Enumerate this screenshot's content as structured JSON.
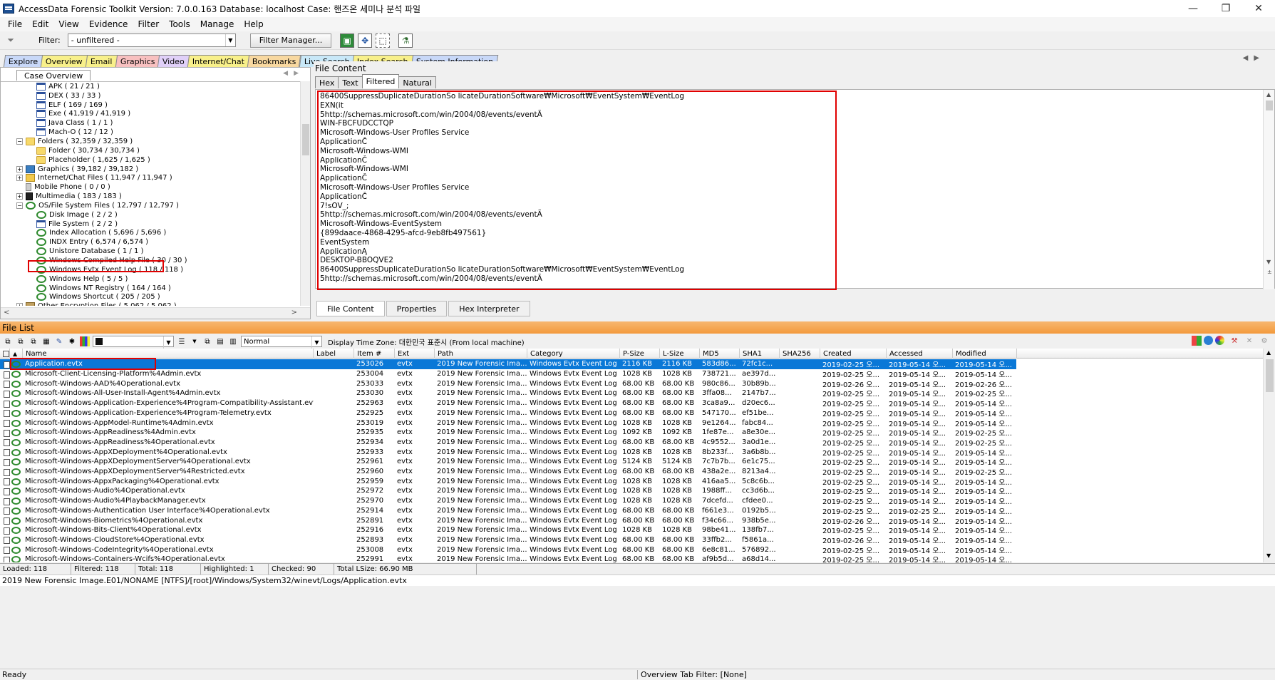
{
  "window": {
    "title": "AccessData Forensic Toolkit Version: 7.0.0.163 Database: localhost Case: 핸즈온 세미나 분석 파일",
    "minimize": "—",
    "maximize": "❐",
    "close": "✕"
  },
  "menu": [
    "File",
    "Edit",
    "View",
    "Evidence",
    "Filter",
    "Tools",
    "Manage",
    "Help"
  ],
  "toolbar": {
    "filter_label": "Filter:",
    "filter_value": "- unfiltered -",
    "filter_manager": "Filter Manager..."
  },
  "main_tabs": [
    {
      "label": "Explore",
      "color": "#c8d8f8"
    },
    {
      "label": "Overview",
      "color": "#f8f08a"
    },
    {
      "label": "Email",
      "color": "#f8f08a"
    },
    {
      "label": "Graphics",
      "color": "#f8c0c0"
    },
    {
      "label": "Video",
      "color": "#e0d0f8"
    },
    {
      "label": "Internet/Chat",
      "color": "#f8f08a"
    },
    {
      "label": "Bookmarks",
      "color": "#f8d8a0"
    },
    {
      "label": "Live Search",
      "color": "#c8e8f8"
    },
    {
      "label": "Index Search",
      "color": "#f8f08a"
    },
    {
      "label": "System Information",
      "color": "#c8d8f8"
    }
  ],
  "tree": {
    "tab": "Case Overview",
    "rows": [
      {
        "label": "APK ( 21 / 21 )",
        "indent": 2,
        "icon": "doc"
      },
      {
        "label": "DEX ( 33 / 33 )",
        "indent": 2,
        "icon": "doc"
      },
      {
        "label": "ELF ( 169 / 169 )",
        "indent": 2,
        "icon": "doc"
      },
      {
        "label": "Exe ( 41,919 / 41,919 )",
        "indent": 2,
        "icon": "doc"
      },
      {
        "label": "Java Class ( 1 / 1 )",
        "indent": 2,
        "icon": "doc"
      },
      {
        "label": "Mach-O ( 12 / 12 )",
        "indent": 2,
        "icon": "doc"
      },
      {
        "label": "Folders ( 32,359 / 32,359 )",
        "indent": 1,
        "icon": "folder",
        "exp": "−"
      },
      {
        "label": "Folder ( 30,734 / 30,734 )",
        "indent": 2,
        "icon": "folder"
      },
      {
        "label": "Placeholder ( 1,625 / 1,625 )",
        "indent": 2,
        "icon": "folder"
      },
      {
        "label": "Graphics ( 39,182 / 39,182 )",
        "indent": 1,
        "icon": "gfx",
        "exp": "+"
      },
      {
        "label": "Internet/Chat Files ( 11,947 / 11,947 )",
        "indent": 1,
        "icon": "chat",
        "exp": "+"
      },
      {
        "label": "Mobile Phone ( 0 / 0 )",
        "indent": 1,
        "icon": "mobile"
      },
      {
        "label": "Multimedia ( 183 / 183 )",
        "indent": 1,
        "icon": "media",
        "exp": "+"
      },
      {
        "label": "OS/File System Files ( 12,797 / 12,797 )",
        "indent": 1,
        "icon": "evt",
        "exp": "−"
      },
      {
        "label": "Disk Image ( 2 / 2 )",
        "indent": 2,
        "icon": "evt"
      },
      {
        "label": "File System ( 2 / 2 )",
        "indent": 2,
        "icon": "doc"
      },
      {
        "label": "Index Allocation ( 5,696 / 5,696 )",
        "indent": 2,
        "icon": "evt"
      },
      {
        "label": "INDX Entry ( 6,574 / 6,574 )",
        "indent": 2,
        "icon": "evt"
      },
      {
        "label": "Unistore Database ( 1 / 1 )",
        "indent": 2,
        "icon": "evt"
      },
      {
        "label": "Windows Compiled Help File ( 30 / 30 )",
        "indent": 2,
        "icon": "evt"
      },
      {
        "label": "Windows Evtx Event Log ( 118 / 118 )",
        "indent": 2,
        "icon": "evt"
      },
      {
        "label": "Windows Help ( 5 / 5 )",
        "indent": 2,
        "icon": "evt"
      },
      {
        "label": "Windows NT Registry ( 164 / 164 )",
        "indent": 2,
        "icon": "evt"
      },
      {
        "label": "Windows Shortcut ( 205 / 205 )",
        "indent": 2,
        "icon": "evt"
      },
      {
        "label": "Other Encryption Files ( 5,062 / 5,062 )",
        "indent": 1,
        "icon": "key",
        "exp": "+"
      }
    ]
  },
  "file_content": {
    "title": "File Content",
    "tabs": [
      "Hex",
      "Text",
      "Filtered",
      "Natural"
    ],
    "active_tab": "Filtered",
    "lines": [
      "86400SuppressDuplicateDurationSo licateDurationSoftware₩Microsoft₩EventSystem₩EventLog",
      "EXN(it",
      "5http://schemas.microsoft.com/win/2004/08/events/eventÃ",
      "WIN-FBCFUDCCTQP",
      "Microsoft-Windows-User Profiles Service",
      "ApplicationČ",
      "Microsoft-Windows-WMI",
      "ApplicationČ",
      "Microsoft-Windows-WMI",
      "ApplicationČ",
      "Microsoft-Windows-User Profiles Service",
      "ApplicationČ",
      "7!sOV_;",
      "5http://schemas.microsoft.com/win/2004/08/events/eventÃ",
      "Microsoft-Windows-EventSystem",
      "{899daace-4868-4295-afcd-9eb8fb497561}",
      "EventSystem",
      "ApplicationĄ",
      "DESKTOP-BBOQVE2",
      "86400SuppressDuplicateDurationSo licateDurationSoftware₩Microsoft₩EventSystem₩EventLog",
      "5http://schemas.microsoft.com/win/2004/08/events/eventÃ"
    ],
    "bottom_tabs": [
      "File Content",
      "Properties",
      "Hex Interpreter"
    ]
  },
  "file_list": {
    "title": "File List",
    "view_mode": "Normal",
    "timezone": "Display Time Zone: 대한민국 표준시  (From local machine)",
    "columns": [
      "Name",
      "Label",
      "Item #",
      "Ext",
      "Path",
      "Category",
      "P-Size",
      "L-Size",
      "MD5",
      "SHA1",
      "SHA256",
      "Created",
      "Accessed",
      "Modified"
    ],
    "rows": [
      {
        "name": "Application.evtx",
        "item": "253026",
        "ext": "evtx",
        "path": "2019 New Forensic Ima...",
        "cat": "Windows Evtx Event Log",
        "ps": "2116 KB",
        "ls": "2116 KB",
        "md5": "583d86...",
        "sha1": "72fc1c...",
        "created": "2019-02-25 오...",
        "accessed": "2019-05-14 오...",
        "modified": "2019-05-14 오..."
      },
      {
        "name": "Microsoft-Client-Licensing-Platform%4Admin.evtx",
        "item": "253004",
        "ext": "evtx",
        "path": "2019 New Forensic Ima...",
        "cat": "Windows Evtx Event Log",
        "ps": "1028 KB",
        "ls": "1028 KB",
        "md5": "738721...",
        "sha1": "ae397d...",
        "created": "2019-02-25 오...",
        "accessed": "2019-05-14 오...",
        "modified": "2019-05-14 오..."
      },
      {
        "name": "Microsoft-Windows-AAD%4Operational.evtx",
        "item": "253033",
        "ext": "evtx",
        "path": "2019 New Forensic Ima...",
        "cat": "Windows Evtx Event Log",
        "ps": "68.00 KB",
        "ls": "68.00 KB",
        "md5": "980c86...",
        "sha1": "30b89b...",
        "created": "2019-02-26 오...",
        "accessed": "2019-05-14 오...",
        "modified": "2019-02-26 오..."
      },
      {
        "name": "Microsoft-Windows-All-User-Install-Agent%4Admin.evtx",
        "item": "253030",
        "ext": "evtx",
        "path": "2019 New Forensic Ima...",
        "cat": "Windows Evtx Event Log",
        "ps": "68.00 KB",
        "ls": "68.00 KB",
        "md5": "3ffa08...",
        "sha1": "2147b7...",
        "created": "2019-02-25 오...",
        "accessed": "2019-05-14 오...",
        "modified": "2019-02-25 오..."
      },
      {
        "name": "Microsoft-Windows-Application-Experience%4Program-Compatibility-Assistant.evtx",
        "item": "252963",
        "ext": "evtx",
        "path": "2019 New Forensic Ima...",
        "cat": "Windows Evtx Event Log",
        "ps": "68.00 KB",
        "ls": "68.00 KB",
        "md5": "3ca8a9...",
        "sha1": "d20ec6...",
        "created": "2019-02-25 오...",
        "accessed": "2019-05-14 오...",
        "modified": "2019-05-14 오..."
      },
      {
        "name": "Microsoft-Windows-Application-Experience%4Program-Telemetry.evtx",
        "item": "252925",
        "ext": "evtx",
        "path": "2019 New Forensic Ima...",
        "cat": "Windows Evtx Event Log",
        "ps": "68.00 KB",
        "ls": "68.00 KB",
        "md5": "547170...",
        "sha1": "ef51be...",
        "created": "2019-02-25 오...",
        "accessed": "2019-05-14 오...",
        "modified": "2019-05-14 오..."
      },
      {
        "name": "Microsoft-Windows-AppModel-Runtime%4Admin.evtx",
        "item": "253019",
        "ext": "evtx",
        "path": "2019 New Forensic Ima...",
        "cat": "Windows Evtx Event Log",
        "ps": "1028 KB",
        "ls": "1028 KB",
        "md5": "9e1264...",
        "sha1": "fabc84...",
        "created": "2019-02-25 오...",
        "accessed": "2019-05-14 오...",
        "modified": "2019-05-14 오..."
      },
      {
        "name": "Microsoft-Windows-AppReadiness%4Admin.evtx",
        "item": "252935",
        "ext": "evtx",
        "path": "2019 New Forensic Ima...",
        "cat": "Windows Evtx Event Log",
        "ps": "1092 KB",
        "ls": "1092 KB",
        "md5": "1fe87e...",
        "sha1": "a8e30e...",
        "created": "2019-02-25 오...",
        "accessed": "2019-05-14 오...",
        "modified": "2019-02-25 오..."
      },
      {
        "name": "Microsoft-Windows-AppReadiness%4Operational.evtx",
        "item": "252934",
        "ext": "evtx",
        "path": "2019 New Forensic Ima...",
        "cat": "Windows Evtx Event Log",
        "ps": "68.00 KB",
        "ls": "68.00 KB",
        "md5": "4c9552...",
        "sha1": "3a0d1e...",
        "created": "2019-02-25 오...",
        "accessed": "2019-05-14 오...",
        "modified": "2019-02-25 오..."
      },
      {
        "name": "Microsoft-Windows-AppXDeployment%4Operational.evtx",
        "item": "252933",
        "ext": "evtx",
        "path": "2019 New Forensic Ima...",
        "cat": "Windows Evtx Event Log",
        "ps": "1028 KB",
        "ls": "1028 KB",
        "md5": "8b233f...",
        "sha1": "3a6b8b...",
        "created": "2019-02-25 오...",
        "accessed": "2019-05-14 오...",
        "modified": "2019-05-14 오..."
      },
      {
        "name": "Microsoft-Windows-AppXDeploymentServer%4Operational.evtx",
        "item": "252961",
        "ext": "evtx",
        "path": "2019 New Forensic Ima...",
        "cat": "Windows Evtx Event Log",
        "ps": "5124 KB",
        "ls": "5124 KB",
        "md5": "7c7b7b...",
        "sha1": "6e1c75...",
        "created": "2019-02-25 오...",
        "accessed": "2019-05-14 오...",
        "modified": "2019-05-14 오..."
      },
      {
        "name": "Microsoft-Windows-AppXDeploymentServer%4Restricted.evtx",
        "item": "252960",
        "ext": "evtx",
        "path": "2019 New Forensic Ima...",
        "cat": "Windows Evtx Event Log",
        "ps": "68.00 KB",
        "ls": "68.00 KB",
        "md5": "438a2e...",
        "sha1": "8213a4...",
        "created": "2019-02-25 오...",
        "accessed": "2019-05-14 오...",
        "modified": "2019-02-25 오..."
      },
      {
        "name": "Microsoft-Windows-AppxPackaging%4Operational.evtx",
        "item": "252959",
        "ext": "evtx",
        "path": "2019 New Forensic Ima...",
        "cat": "Windows Evtx Event Log",
        "ps": "1028 KB",
        "ls": "1028 KB",
        "md5": "416aa5...",
        "sha1": "5c8c6b...",
        "created": "2019-02-25 오...",
        "accessed": "2019-05-14 오...",
        "modified": "2019-05-14 오..."
      },
      {
        "name": "Microsoft-Windows-Audio%4Operational.evtx",
        "item": "252972",
        "ext": "evtx",
        "path": "2019 New Forensic Ima...",
        "cat": "Windows Evtx Event Log",
        "ps": "1028 KB",
        "ls": "1028 KB",
        "md5": "1988ff...",
        "sha1": "cc3d6b...",
        "created": "2019-02-25 오...",
        "accessed": "2019-05-14 오...",
        "modified": "2019-05-14 오..."
      },
      {
        "name": "Microsoft-Windows-Audio%4PlaybackManager.evtx",
        "item": "252970",
        "ext": "evtx",
        "path": "2019 New Forensic Ima...",
        "cat": "Windows Evtx Event Log",
        "ps": "1028 KB",
        "ls": "1028 KB",
        "md5": "7dcefd...",
        "sha1": "cfdee0...",
        "created": "2019-02-25 오...",
        "accessed": "2019-05-14 오...",
        "modified": "2019-05-14 오..."
      },
      {
        "name": "Microsoft-Windows-Authentication User Interface%4Operational.evtx",
        "item": "252914",
        "ext": "evtx",
        "path": "2019 New Forensic Ima...",
        "cat": "Windows Evtx Event Log",
        "ps": "68.00 KB",
        "ls": "68.00 KB",
        "md5": "f661e3...",
        "sha1": "0192b5...",
        "created": "2019-02-25 오...",
        "accessed": "2019-02-25 오...",
        "modified": "2019-05-14 오..."
      },
      {
        "name": "Microsoft-Windows-Biometrics%4Operational.evtx",
        "item": "252891",
        "ext": "evtx",
        "path": "2019 New Forensic Ima...",
        "cat": "Windows Evtx Event Log",
        "ps": "68.00 KB",
        "ls": "68.00 KB",
        "md5": "f34c66...",
        "sha1": "938b5e...",
        "created": "2019-02-26 오...",
        "accessed": "2019-05-14 오...",
        "modified": "2019-05-14 오..."
      },
      {
        "name": "Microsoft-Windows-Bits-Client%4Operational.evtx",
        "item": "252916",
        "ext": "evtx",
        "path": "2019 New Forensic Ima...",
        "cat": "Windows Evtx Event Log",
        "ps": "1028 KB",
        "ls": "1028 KB",
        "md5": "98be41...",
        "sha1": "138fb7...",
        "created": "2019-02-25 오...",
        "accessed": "2019-05-14 오...",
        "modified": "2019-05-14 오..."
      },
      {
        "name": "Microsoft-Windows-CloudStore%4Operational.evtx",
        "item": "252893",
        "ext": "evtx",
        "path": "2019 New Forensic Ima...",
        "cat": "Windows Evtx Event Log",
        "ps": "68.00 KB",
        "ls": "68.00 KB",
        "md5": "33ffb2...",
        "sha1": "f5861a...",
        "created": "2019-02-26 오...",
        "accessed": "2019-05-14 오...",
        "modified": "2019-05-14 오..."
      },
      {
        "name": "Microsoft-Windows-CodeIntegrity%4Operational.evtx",
        "item": "253008",
        "ext": "evtx",
        "path": "2019 New Forensic Ima...",
        "cat": "Windows Evtx Event Log",
        "ps": "68.00 KB",
        "ls": "68.00 KB",
        "md5": "6e8c81...",
        "sha1": "576892...",
        "created": "2019-02-25 오...",
        "accessed": "2019-05-14 오...",
        "modified": "2019-05-14 오..."
      },
      {
        "name": "Microsoft-Windows-Containers-Wcifs%4Operational.evtx",
        "item": "252991",
        "ext": "evtx",
        "path": "2019 New Forensic Ima...",
        "cat": "Windows Evtx Event Log",
        "ps": "68.00 KB",
        "ls": "68.00 KB",
        "md5": "af9b5d...",
        "sha1": "a68d14...",
        "created": "2019-02-25 오...",
        "accessed": "2019-05-14 오...",
        "modified": "2019-05-14 오..."
      }
    ]
  },
  "status": {
    "loaded": "Loaded: 118",
    "filtered": "Filtered: 118",
    "total": "Total: 118",
    "highlighted": "Highlighted: 1",
    "checked": "Checked: 90",
    "lsize": "Total LSize: 66.90 MB"
  },
  "path": "2019 New Forensic Image.E01/NONAME [NTFS]/[root]/Windows/System32/winevt/Logs/Application.evtx",
  "ready": "Ready",
  "overview_filter": "Overview Tab Filter: [None]"
}
